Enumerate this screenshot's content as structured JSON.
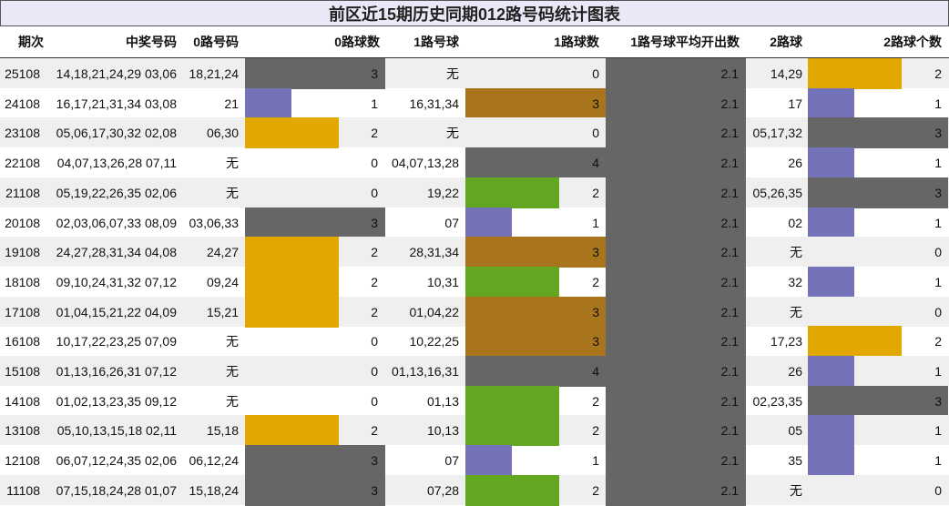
{
  "chart_data": {
    "type": "table",
    "title": "前区近15期历史同期012路号码统计图表",
    "columns": [
      "期次",
      "中奖号码",
      "0路号码",
      "0路球数",
      "1路号球",
      "1路球数",
      "1路号球平均开出数",
      "2路球",
      "2路球个数"
    ],
    "colors": {
      "1": "#7472b8",
      "2": "#e3a800",
      "3": "#666666",
      "4": "#666666",
      "1path_1": "#7472b8",
      "1path_2": "#63a620",
      "1path_3": "#a8751c",
      "1path_4": "#666666",
      "avg": "#666666"
    },
    "rows": [
      {
        "period": "25108",
        "numbers": "14,18,21,24,29 03,06",
        "r0": "18,21,24",
        "c0": 3,
        "r1": "无",
        "c1": 0,
        "avg": 2.1,
        "r2": "14,29",
        "c2": 2
      },
      {
        "period": "24108",
        "numbers": "16,17,21,31,34 03,08",
        "r0": "21",
        "c0": 1,
        "r1": "16,31,34",
        "c1": 3,
        "avg": 2.1,
        "r2": "17",
        "c2": 1
      },
      {
        "period": "23108",
        "numbers": "05,06,17,30,32 02,08",
        "r0": "06,30",
        "c0": 2,
        "r1": "无",
        "c1": 0,
        "avg": 2.1,
        "r2": "05,17,32",
        "c2": 3
      },
      {
        "period": "22108",
        "numbers": "04,07,13,26,28 07,11",
        "r0": "无",
        "c0": 0,
        "r1": "04,07,13,28",
        "c1": 4,
        "avg": 2.1,
        "r2": "26",
        "c2": 1
      },
      {
        "period": "21108",
        "numbers": "05,19,22,26,35 02,06",
        "r0": "无",
        "c0": 0,
        "r1": "19,22",
        "c1": 2,
        "avg": 2.1,
        "r2": "05,26,35",
        "c2": 3
      },
      {
        "period": "20108",
        "numbers": "02,03,06,07,33 08,09",
        "r0": "03,06,33",
        "c0": 3,
        "r1": "07",
        "c1": 1,
        "avg": 2.1,
        "r2": "02",
        "c2": 1
      },
      {
        "period": "19108",
        "numbers": "24,27,28,31,34 04,08",
        "r0": "24,27",
        "c0": 2,
        "r1": "28,31,34",
        "c1": 3,
        "avg": 2.1,
        "r2": "无",
        "c2": 0
      },
      {
        "period": "18108",
        "numbers": "09,10,24,31,32 07,12",
        "r0": "09,24",
        "c0": 2,
        "r1": "10,31",
        "c1": 2,
        "avg": 2.1,
        "r2": "32",
        "c2": 1
      },
      {
        "period": "17108",
        "numbers": "01,04,15,21,22 04,09",
        "r0": "15,21",
        "c0": 2,
        "r1": "01,04,22",
        "c1": 3,
        "avg": 2.1,
        "r2": "无",
        "c2": 0
      },
      {
        "period": "16108",
        "numbers": "10,17,22,23,25 07,09",
        "r0": "无",
        "c0": 0,
        "r1": "10,22,25",
        "c1": 3,
        "avg": 2.1,
        "r2": "17,23",
        "c2": 2
      },
      {
        "period": "15108",
        "numbers": "01,13,16,26,31 07,12",
        "r0": "无",
        "c0": 0,
        "r1": "01,13,16,31",
        "c1": 4,
        "avg": 2.1,
        "r2": "26",
        "c2": 1
      },
      {
        "period": "14108",
        "numbers": "01,02,13,23,35 09,12",
        "r0": "无",
        "c0": 0,
        "r1": "01,13",
        "c1": 2,
        "avg": 2.1,
        "r2": "02,23,35",
        "c2": 3
      },
      {
        "period": "13108",
        "numbers": "05,10,13,15,18 02,11",
        "r0": "15,18",
        "c0": 2,
        "r1": "10,13",
        "c1": 2,
        "avg": 2.1,
        "r2": "05",
        "c2": 1
      },
      {
        "period": "12108",
        "numbers": "06,07,12,24,35 02,06",
        "r0": "06,12,24",
        "c0": 3,
        "r1": "07",
        "c1": 1,
        "avg": 2.1,
        "r2": "35",
        "c2": 1
      },
      {
        "period": "11108",
        "numbers": "07,15,18,24,28 01,07",
        "r0": "15,18,24",
        "c0": 3,
        "r1": "07,28",
        "c1": 2,
        "avg": 2.1,
        "r2": "无",
        "c2": 0
      }
    ]
  }
}
